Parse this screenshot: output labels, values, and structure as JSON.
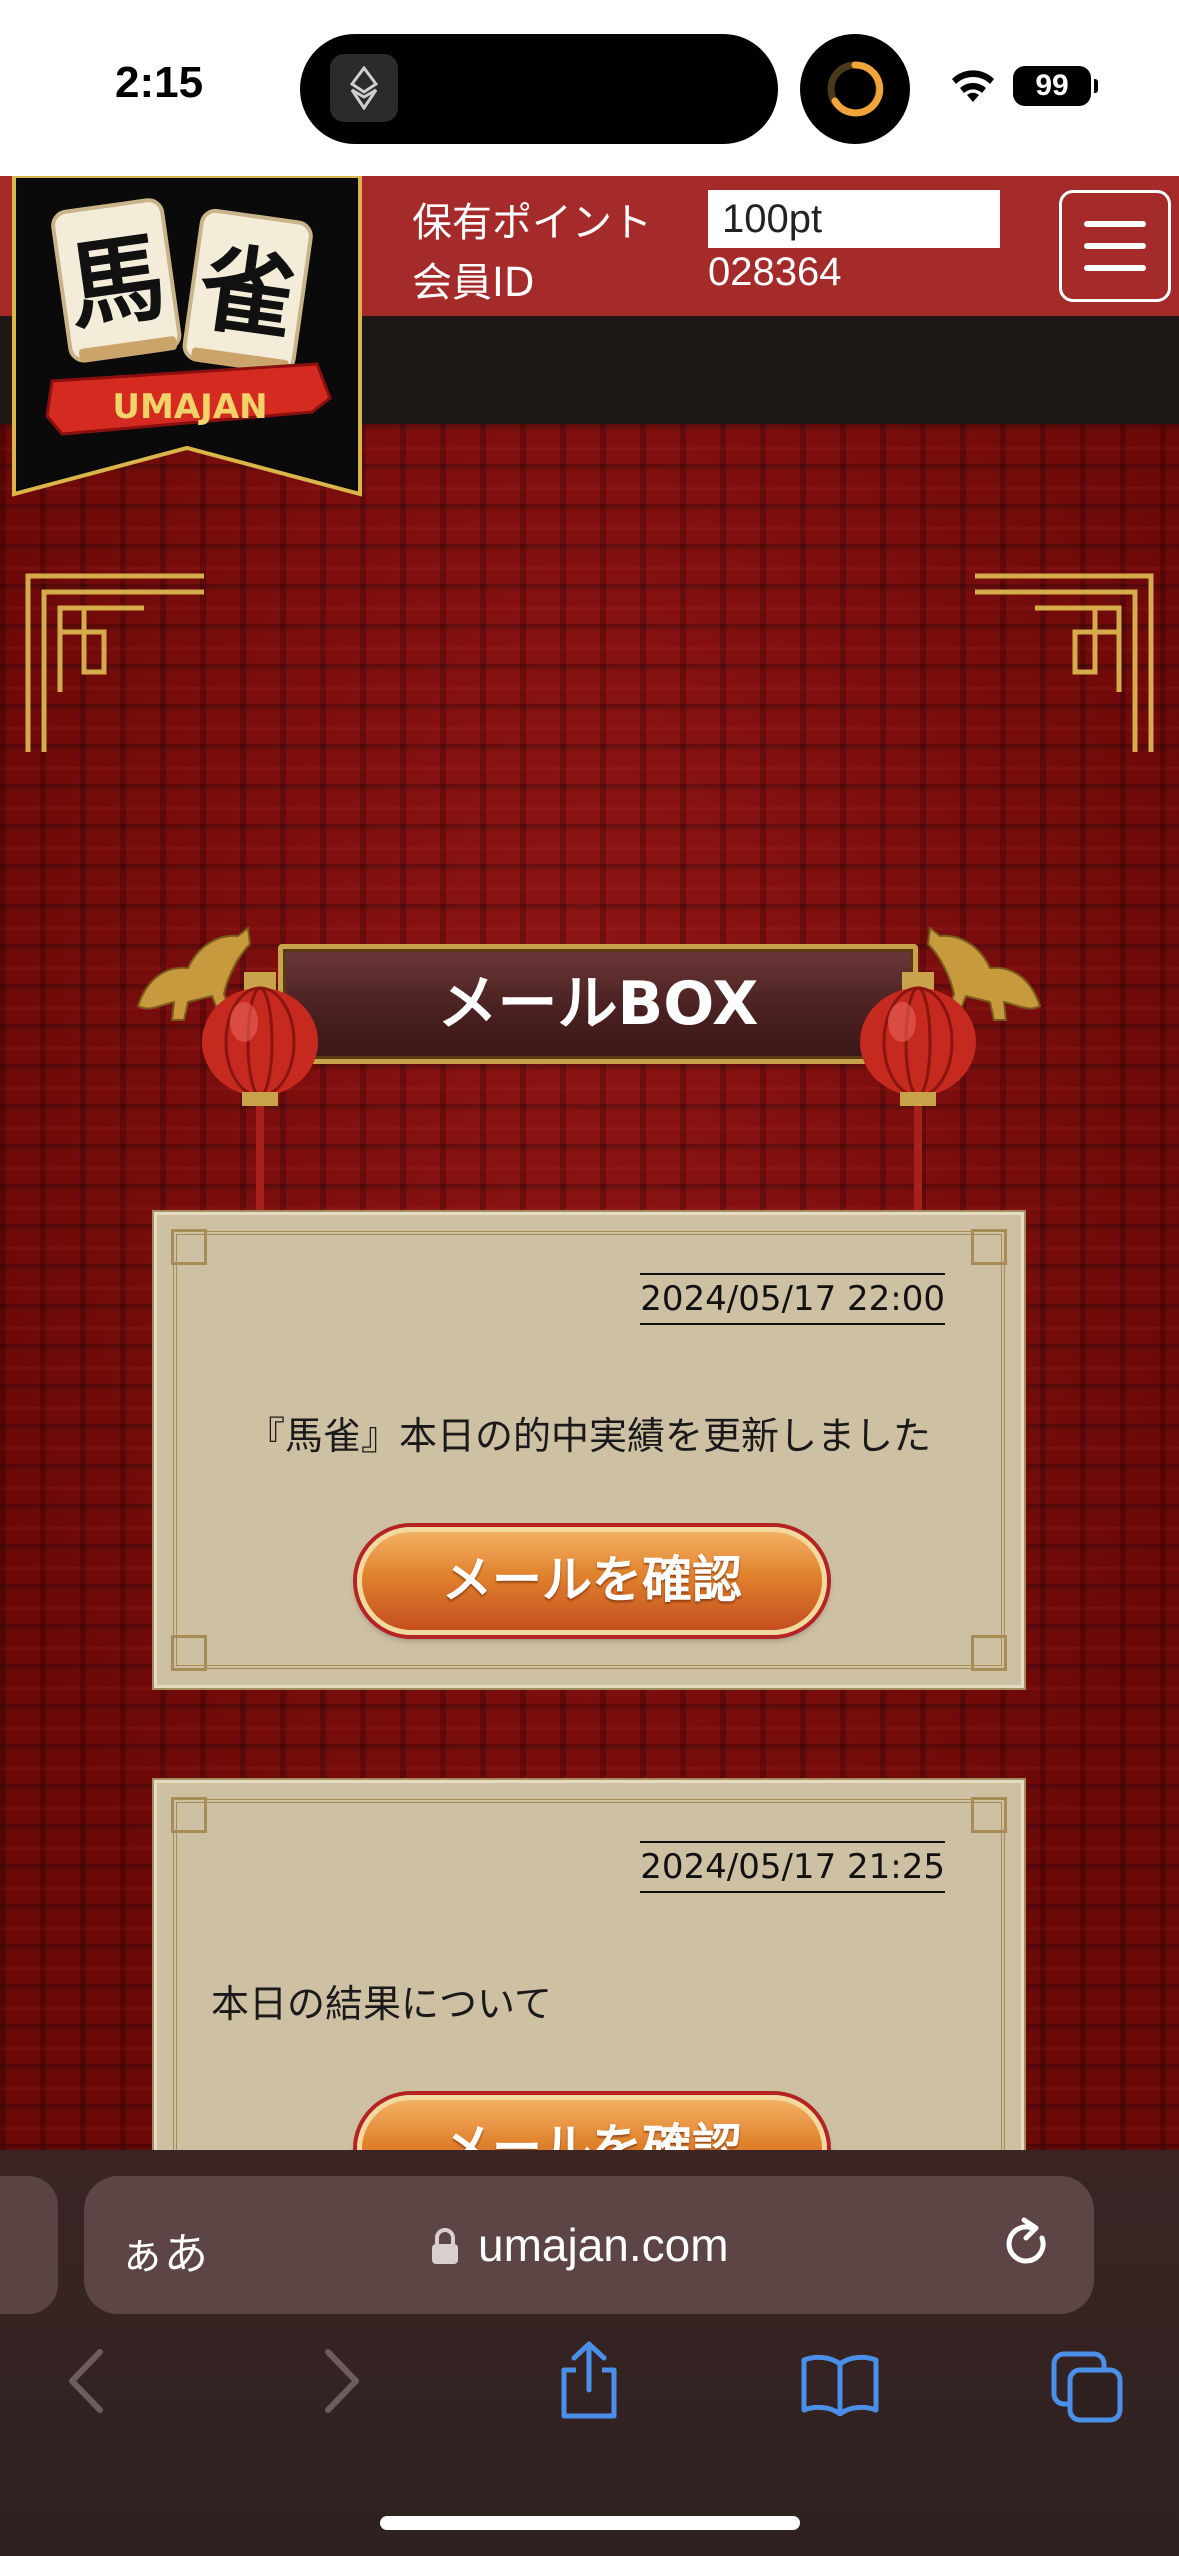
{
  "status_bar": {
    "time": "2:15",
    "battery": "99"
  },
  "header": {
    "logo_text": "UMAJAN",
    "logo_tiles": [
      "馬",
      "雀"
    ],
    "points_label": "保有ポイント",
    "points_value": "100pt",
    "member_id_label": "会員ID",
    "member_id_value": "028364"
  },
  "main": {
    "title": "メールBOX",
    "mails": [
      {
        "date": "2024/05/17 22:00",
        "subject": "『馬雀』本日の的中実績を更新しました",
        "button": "メールを確認"
      },
      {
        "date": "2024/05/17 21:25",
        "subject": "本日の結果について",
        "button": "メールを確認"
      }
    ]
  },
  "browser": {
    "aa_label": "ぁあ",
    "url": "umajan.com"
  },
  "colors": {
    "header_red": "#a52a2a",
    "page_red": "#7a0c0c",
    "card_beige": "#cdc0a3",
    "gold": "#c9a24c",
    "button_orange": "#e0812d",
    "toolbar_blue": "#4a8fe8"
  }
}
